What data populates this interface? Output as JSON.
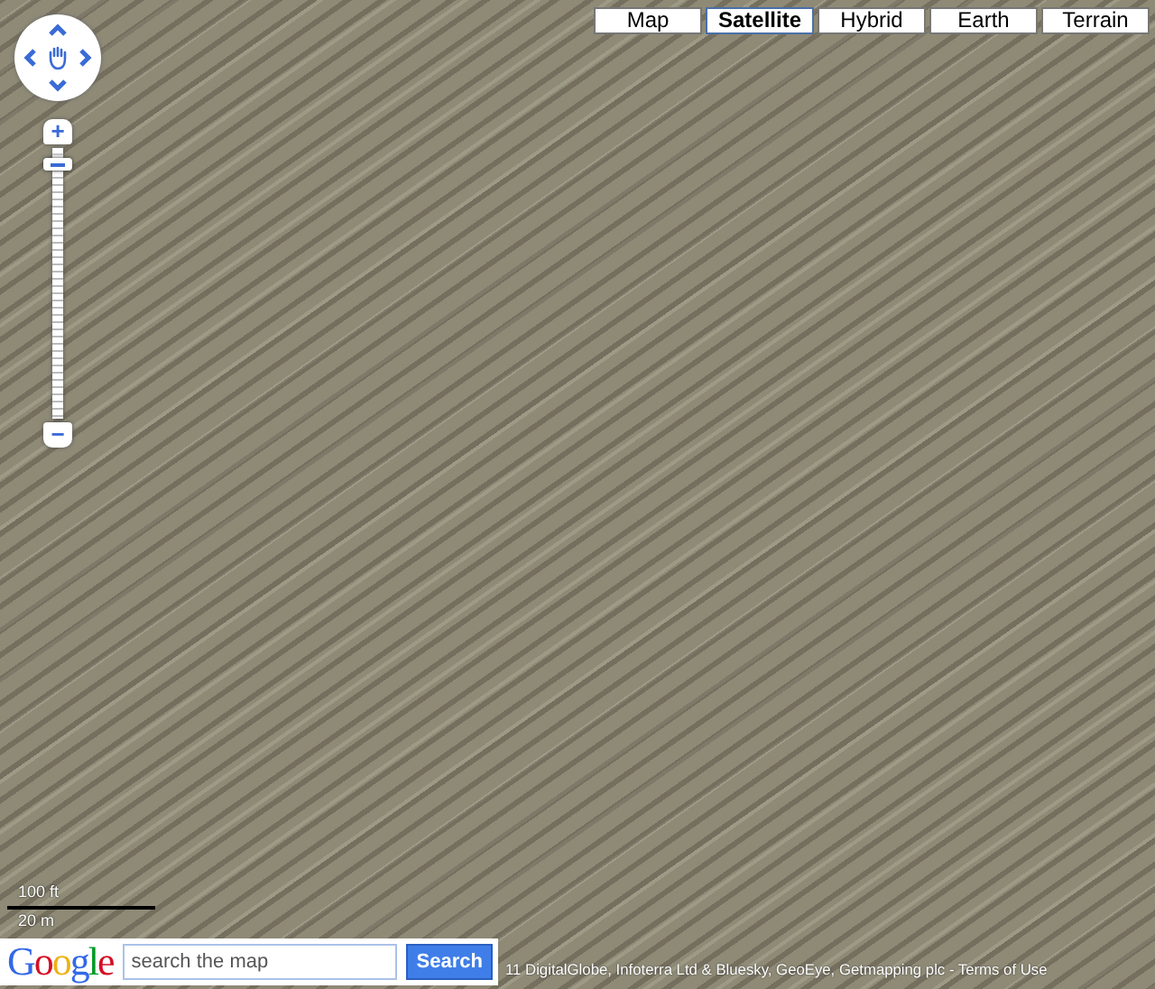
{
  "map_types": [
    {
      "label": "Map",
      "selected": false
    },
    {
      "label": "Satellite",
      "selected": true
    },
    {
      "label": "Hybrid",
      "selected": false
    },
    {
      "label": "Earth",
      "selected": false
    },
    {
      "label": "Terrain",
      "selected": false
    }
  ],
  "zoom": {
    "in": "+",
    "out": "−",
    "level": 0.94
  },
  "scale": {
    "imperial": "100 ft",
    "metric": "20 m"
  },
  "search": {
    "logo": "Google",
    "placeholder": "search the map",
    "button": "Search"
  },
  "attribution": "11 DigitalGlobe, Infoterra Ltd & Bluesky, GeoEye, Getmapping plc - Terms of Use"
}
